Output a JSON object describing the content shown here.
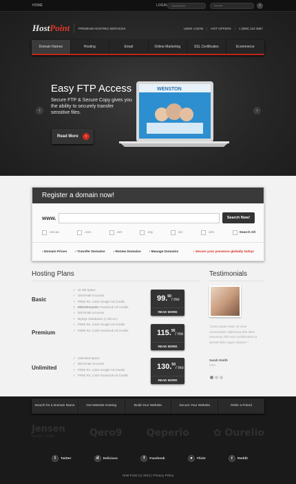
{
  "topbar": {
    "home": "HOME",
    "login": "LOGIN",
    "username_placeholder": "Username",
    "password_placeholder": "••••••••",
    "go": "›"
  },
  "header": {
    "logo_host": "Host",
    "logo_point": "Point",
    "tagline": "PREMIUM HOSTING SERVICES",
    "user_login": "USER LOGIN",
    "hot_offers": "HOT OFFERS",
    "phone": "1 (800) 123 4567"
  },
  "nav": [
    "Domain Names",
    "Hosting",
    "Email",
    "Online Marketing",
    "SSL Certificates",
    "Ecommerce"
  ],
  "slider": {
    "title": "Easy FTP Access",
    "text": "Secure FTP & Secure Copy gives you the ability to securely transfer sensitive files.",
    "button": "Read More",
    "screen_brand": "WENSTON",
    "prev": "‹",
    "next": "›"
  },
  "register": {
    "title": "Register a domain now!",
    "www": "www.",
    "search_button": "Search Now!",
    "tlds": [
      ".net.au",
      ".com",
      ".net",
      ".org",
      ".biz",
      ".info"
    ],
    "search_all": "Search All",
    "links": [
      "Domain Prices",
      "Transfer Domains",
      "Renew Domains",
      "Manage Domains"
    ],
    "promo": "Secure your presence globally today!"
  },
  "plans": {
    "title": "Hosting Plans",
    "items": [
      {
        "name": "Basic",
        "features": [
          "10 GB Space",
          "100 Email Accounts",
          "FREE Rs. 4,504 Google Ad Credits",
          "FREE Rs. 2,252 Facebook Ad Credits"
        ],
        "price": "99.",
        "cents": "50",
        "per": "/ mo",
        "button": "READ MORE"
      },
      {
        "name": "Premium",
        "features": [
          "150 GB Space",
          "200 Email Accounts",
          "MySQL Databases (1 GB ea.)",
          "FREE Rs. 4,504 Google Ad Credits",
          "FREE Rs. 2,252 Facebook Ad Credits"
        ],
        "price": "115.",
        "cents": "50",
        "per": "/ mo",
        "button": "READ MORE"
      },
      {
        "name": "Unlimited",
        "features": [
          "Unlimited Space",
          "300 Email Accounts",
          "FREE Rs. 4,504 Google Ad Credits",
          "FREE Rs. 2,252 Facebook Ad Credits"
        ],
        "price": "130.",
        "cents": "50",
        "per": "/ mo",
        "button": "READ MORE"
      }
    ]
  },
  "testimonials": {
    "title": "Testimonials",
    "quote": "“Lorem ipsum dolor sit amet consectetuer adipiscing elite diam nonummy nibh euis modtincidunt ut laoreet dolo magna aliquam.”",
    "author": "Sarah Smith",
    "company": "USA"
  },
  "footer": {
    "links": [
      "Search for a Domain Name",
      "Get Website Hosting",
      "Build Your Website",
      "Secure Your Website",
      "Refer a Friend"
    ],
    "partners": [
      "Jensen",
      "design studio",
      "Qero9",
      "Qeperio",
      "Ourelio"
    ],
    "social": [
      "Twitter",
      "Delicious",
      "Facebook",
      "Flickr",
      "Reddit"
    ],
    "copyright": "Host Point (c) 2012  |  Privacy Policy"
  }
}
